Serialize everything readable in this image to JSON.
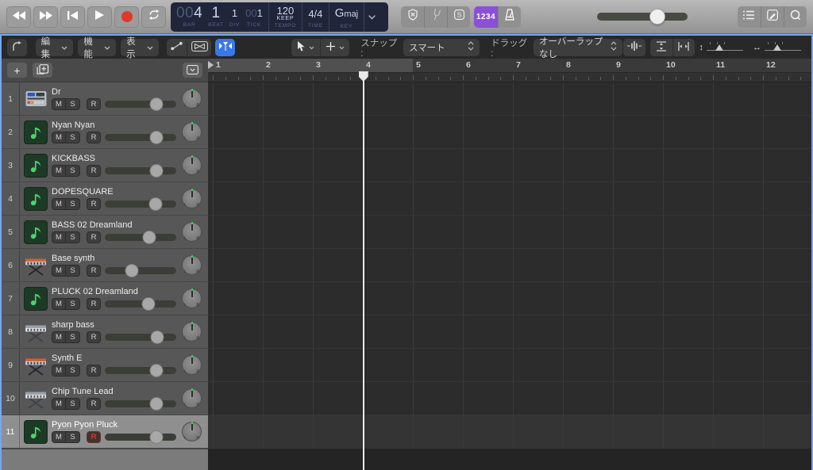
{
  "control_bar": {
    "lcd": {
      "bar_prefix": "00",
      "bar": "4",
      "beat": "1",
      "div": "1",
      "tick_prefix": "00",
      "tick": "1",
      "bar_label": "BAR",
      "beat_label": "BEAT",
      "div_label": "DIV",
      "tick_label": "TICK",
      "tempo_value": "120",
      "tempo_mode": "KEEP",
      "tempo_label": "TEMPO",
      "time_value": "4/4",
      "time_label": "TIME",
      "key_value": "Gmaj",
      "key_letter": "G",
      "key_suffix": "maj",
      "key_label": "KEY"
    },
    "count_in_label": "1234",
    "volume_pct": 67
  },
  "toolbar": {
    "menu_edit": "編集",
    "menu_functions": "機能",
    "menu_view": "表示",
    "snap_label": "スナップ :",
    "snap_value": "スマート",
    "drag_label": "ドラッグ :",
    "drag_value": "オーバーラップなし"
  },
  "track_panel": {
    "msr_labels": [
      "M",
      "S",
      "R"
    ],
    "tracks": [
      {
        "number": "1",
        "name": "Dr",
        "icon": "drum-machine",
        "volume_pct": 72,
        "selected": false,
        "record_armed": false
      },
      {
        "number": "2",
        "name": "Nyan Nyan",
        "icon": "note",
        "volume_pct": 72,
        "selected": false,
        "record_armed": false
      },
      {
        "number": "3",
        "name": "KICKBASS",
        "icon": "note",
        "volume_pct": 72,
        "selected": false,
        "record_armed": false
      },
      {
        "number": "4",
        "name": "DOPESQUARE",
        "icon": "note",
        "volume_pct": 71,
        "selected": false,
        "record_armed": false
      },
      {
        "number": "5",
        "name": "BASS 02 Dreamland",
        "icon": "note",
        "volume_pct": 62,
        "selected": false,
        "record_armed": false
      },
      {
        "number": "6",
        "name": "Base synth",
        "icon": "synth-orange",
        "volume_pct": 38,
        "selected": false,
        "record_armed": false
      },
      {
        "number": "7",
        "name": "PLUCK 02 Dreamland",
        "icon": "note",
        "volume_pct": 61,
        "selected": false,
        "record_armed": false
      },
      {
        "number": "8",
        "name": "sharp bass",
        "icon": "synth-gray",
        "volume_pct": 73,
        "selected": false,
        "record_armed": false
      },
      {
        "number": "9",
        "name": "Synth E",
        "icon": "synth-orange",
        "volume_pct": 72,
        "selected": false,
        "record_armed": false
      },
      {
        "number": "10",
        "name": "Chip Tune Lead",
        "icon": "synth-gray",
        "volume_pct": 72,
        "selected": false,
        "record_armed": false
      },
      {
        "number": "11",
        "name": "Pyon Pyon Pluck",
        "icon": "note",
        "volume_pct": 72,
        "selected": true,
        "record_armed": true
      }
    ]
  },
  "ruler": {
    "bars": [
      "1",
      "2",
      "3",
      "4",
      "5",
      "6",
      "7",
      "8",
      "9",
      "10",
      "11",
      "12"
    ],
    "beats_per_bar": 4,
    "playhead_bar": 4,
    "content_bars": 4
  },
  "colors": {
    "accent_blue": "#3b78e7",
    "count_in_purple": "#8a50d7",
    "record_red": "#e0382c",
    "armed_red": "#ff453a",
    "note_green": "#4fd36b",
    "window_outline": "#74a7f2"
  }
}
